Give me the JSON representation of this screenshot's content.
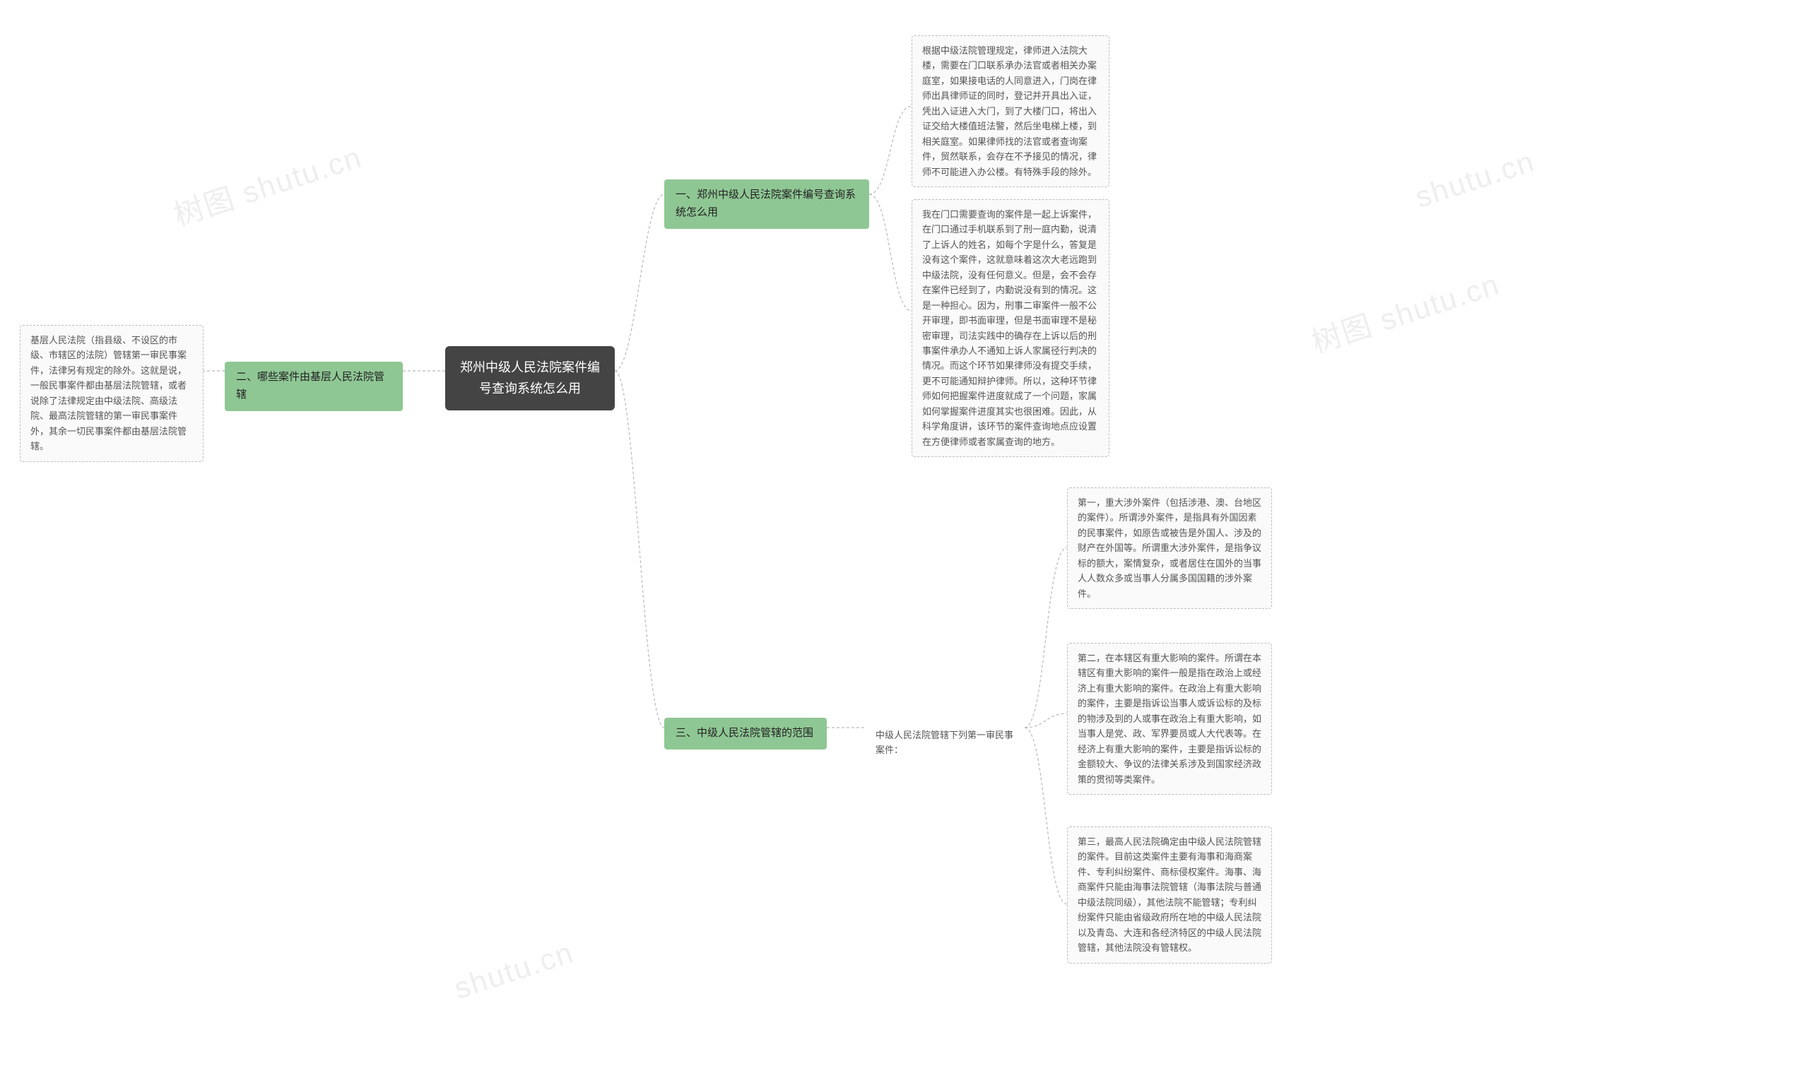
{
  "root": {
    "title": "郑州中级人民法院案件编号查询系统怎么用"
  },
  "left": {
    "section2": {
      "title": "二、哪些案件由基层人民法院管辖",
      "leaf": "基层人民法院（指县级、不设区的市级、市辖区的法院）管辖第一审民事案件，法律另有规定的除外。这就是说，一般民事案件都由基层法院管辖，或者说除了法律规定由中级法院、高级法院、最高法院管辖的第一审民事案件外，其余一切民事案件都由基层法院管辖。"
    }
  },
  "right": {
    "section1": {
      "title": "一、郑州中级人民法院案件编号查询系统怎么用",
      "leaf1": "根据中级法院管理规定，律师进入法院大楼，需要在门口联系承办法官或者相关办案庭室，如果接电话的人同意进入，门岗在律师出具律师证的同时，登记并开具出入证，凭出入证进入大门，到了大楼门口，将出入证交给大楼值班法警，然后坐电梯上楼，到相关庭室。如果律师找的法官或者查询案件，贸然联系，会存在不予接见的情况，律师不可能进入办公楼。有特殊手段的除外。",
      "leaf2": "我在门口需要查询的案件是一起上诉案件，在门口通过手机联系到了刑一庭内勤，说清了上诉人的姓名，如每个字是什么，答复是没有这个案件，这就意味着这次大老远跑到中级法院，没有任何意义。但是，会不会存在案件已经到了，内勤说没有到的情况。这是一种担心。因为，刑事二审案件一般不公开审理，即书面审理，但是书面审理不是秘密审理，司法实践中的确存在上诉以后的刑事案件承办人不通知上诉人家属径行判决的情况。而这个环节如果律师没有提交手续，更不可能通知辩护律师。所以，这种环节律师如何把握案件进度就成了一个问题，家属如何掌握案件进度其实也很困难。因此，从科学角度讲，该环节的案件查询地点应设置在方便律师或者家属查询的地方。"
    },
    "section3": {
      "title": "三、中级人民法院管辖的范围",
      "mid": "中级人民法院管辖下列第一审民事案件：",
      "leaf1": "第一，重大涉外案件（包括涉港、澳、台地区的案件）。所谓涉外案件，是指具有外国因素的民事案件，如原告或被告是外国人、涉及的财产在外国等。所谓重大涉外案件，是指争议标的额大，案情复杂，或者居住在国外的当事人人数众多或当事人分属多国国籍的涉外案件。",
      "leaf2": "第二，在本辖区有重大影响的案件。所谓在本辖区有重大影响的案件一般是指在政治上或经济上有重大影响的案件。在政治上有重大影响的案件，主要是指诉讼当事人或诉讼标的及标的物涉及到的人或事在政治上有重大影响，如当事人是党、政、军界要员或人大代表等。在经济上有重大影响的案件，主要是指诉讼标的金额较大、争议的法律关系涉及到国家经济政策的贯彻等类案件。",
      "leaf3": "第三，最高人民法院确定由中级人民法院管辖的案件。目前这类案件主要有海事和海商案件、专利纠纷案件、商标侵权案件。海事、海商案件只能由海事法院管辖（海事法院与普通中级法院同级），其他法院不能管辖；专利纠纷案件只能由省级政府所在地的中级人民法院以及青岛、大连和各经济特区的中级人民法院管辖，其他法院没有管辖权。"
    }
  },
  "watermarks": {
    "w1": "树图 shutu.cn",
    "w2": "shutu.cn",
    "w3": "树图 shutu.cn",
    "w4": "shutu.cn"
  }
}
